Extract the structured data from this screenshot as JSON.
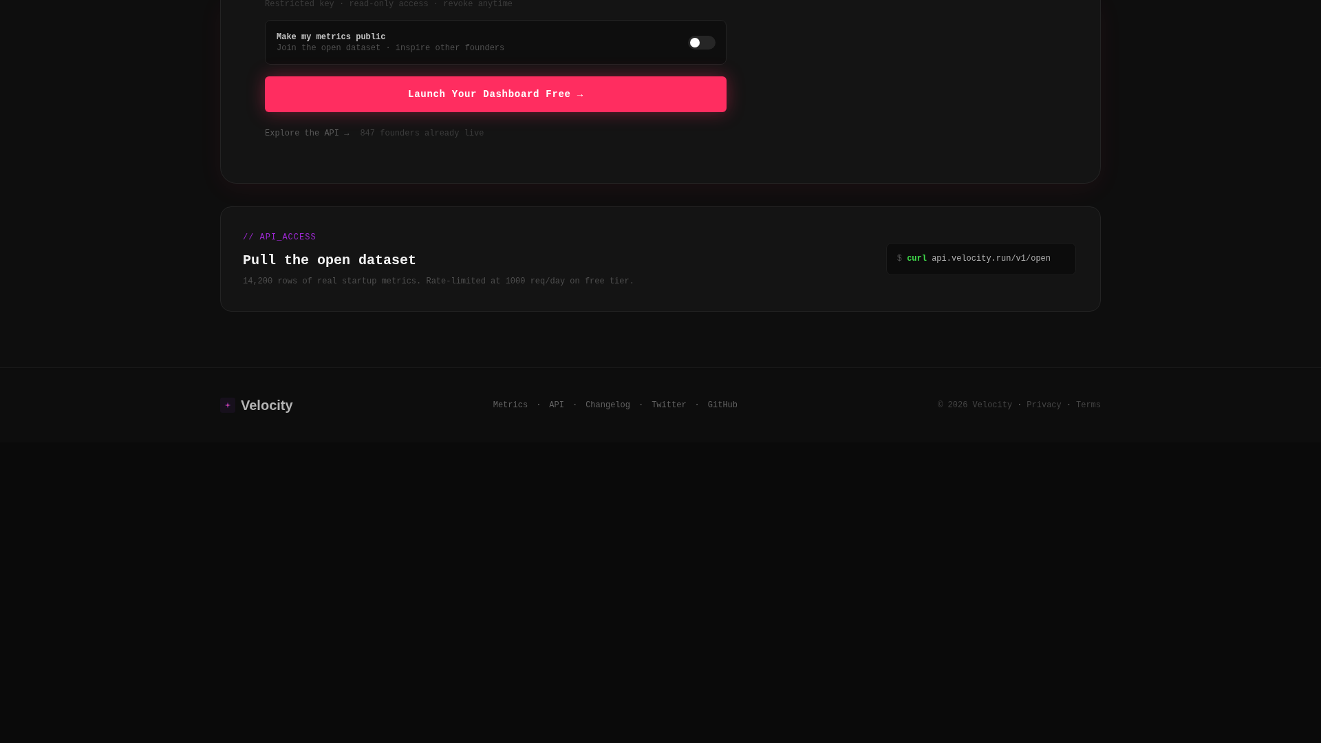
{
  "consent_card": {
    "note": "Restricted key · read-only access · revoke anytime",
    "public_toggle": {
      "title": "Make my metrics public",
      "subtitle": "Join the open dataset · inspire other founders",
      "on": false
    },
    "cta_button": "Launch Your Dashboard Free →",
    "secondary": [
      {
        "kind": "link",
        "text": "Explore the API →"
      },
      {
        "kind": "text",
        "text": "847 founders already live"
      }
    ]
  },
  "api_card": {
    "label": "// API_ACCESS",
    "title": "Pull the open dataset",
    "description": "14,200 rows of real startup metrics. Rate-limited at 1000 req/day on free tier.",
    "command": {
      "prompt": "$",
      "program": "curl",
      "argument": "api.velocity.run/v1/open"
    }
  },
  "footer": {
    "brand": "Velocity",
    "nav": [
      {
        "kind": "link",
        "text": "Metrics"
      },
      {
        "kind": "separator",
        "text": "·"
      },
      {
        "kind": "link",
        "text": "API"
      },
      {
        "kind": "separator",
        "text": "·"
      },
      {
        "kind": "link",
        "text": "Changelog"
      },
      {
        "kind": "separator",
        "text": "·"
      },
      {
        "kind": "link",
        "text": "Twitter"
      },
      {
        "kind": "separator",
        "text": "·"
      },
      {
        "kind": "link",
        "text": "GitHub"
      }
    ],
    "legal": [
      {
        "kind": "text",
        "text": "© 2026 Velocity"
      },
      {
        "kind": "separator",
        "text": "·"
      },
      {
        "kind": "link",
        "text": "Privacy"
      },
      {
        "kind": "separator",
        "text": "·"
      },
      {
        "kind": "link",
        "text": "Terms"
      }
    ]
  }
}
